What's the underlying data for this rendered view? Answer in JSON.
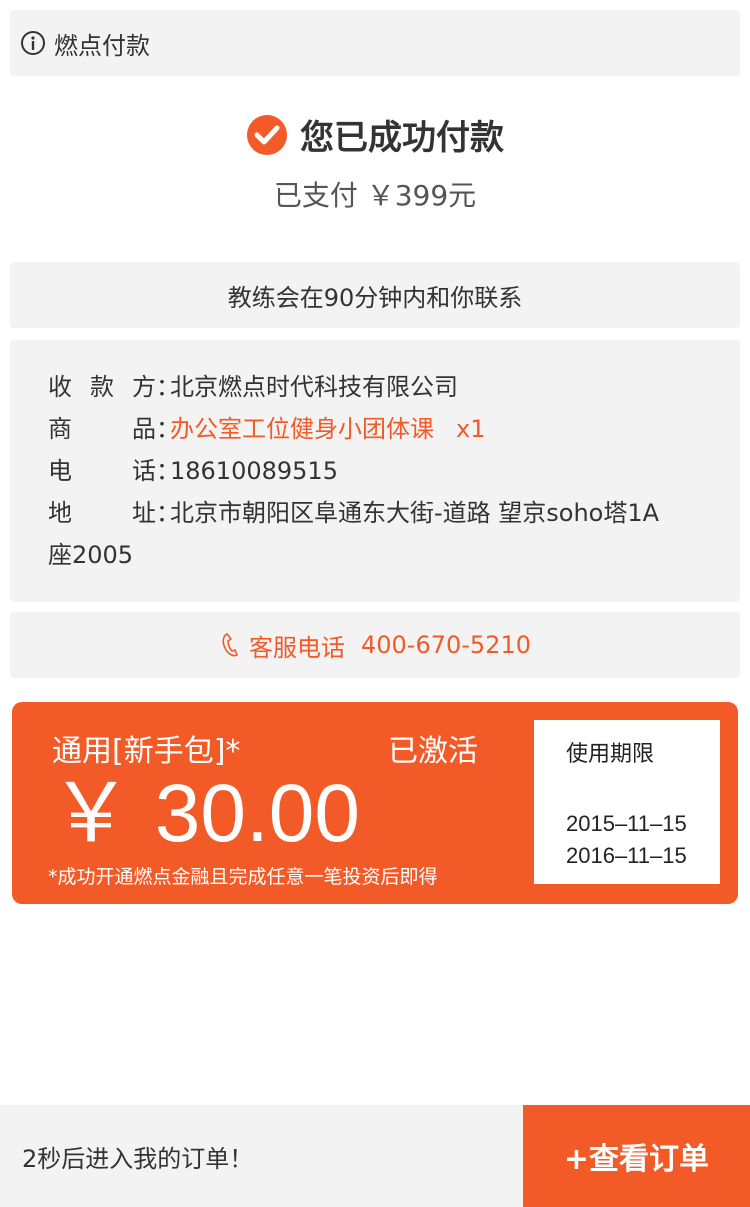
{
  "header": {
    "title": "燃点付款",
    "icon": "info-icon"
  },
  "success": {
    "message": "您已成功付款",
    "paid_text": "已支付 ￥399元",
    "icon": "check-circle-icon",
    "icon_color": "#f25a27"
  },
  "notice": {
    "text": "教练会在90分钟内和你联系"
  },
  "details": {
    "payee_label": "收款方",
    "payee_value": "北京燃点时代科技有限公司",
    "product_label": "商品",
    "product_value": "办公室工位健身小团体课",
    "product_qty": "x1",
    "phone_label": "电话",
    "phone_value": "18610089515",
    "address_label": "地址",
    "address_value": "北京市朝阳区阜通东大街-道路 望京soho塔1A",
    "address_cont": "座2005",
    "colon": "："
  },
  "service": {
    "label": "客服电话",
    "number": "400-670-5210",
    "icon": "phone-icon"
  },
  "coupon": {
    "name": "通用[新手包]*",
    "status": "已激活",
    "amount": "￥ 30.00",
    "note": "*成功开通燃点金融且完成任意一笔投资后即得",
    "validity_label": "使用期限",
    "start_date": "2015–11–15",
    "end_date": "2016–11–15",
    "bg_color": "#f25a27"
  },
  "footer": {
    "countdown": "2秒后进入我的订单！",
    "button_label": "+查看订单"
  }
}
